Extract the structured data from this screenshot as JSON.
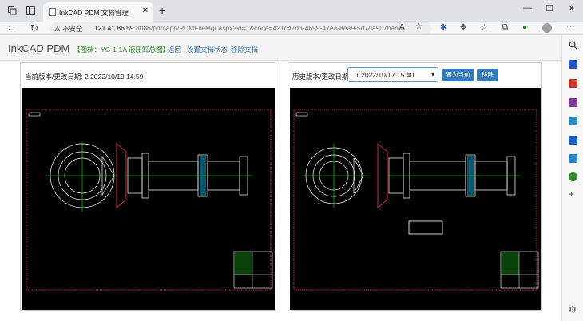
{
  "browser": {
    "tab_title": "InkCAD PDM 文档管理",
    "tab_close": "✕",
    "new_tab": "+",
    "insecure_label": "⚠ 不安全",
    "url_host": "121.41.86.59",
    "url_rest": ":8086/pdmapp/PDMFileMgr.aspx?id=1&code=421c47d3-4699-47ea-8ea9-5d7da907bab6...",
    "window_controls": [
      "—",
      "☐",
      "✕"
    ]
  },
  "header": {
    "brand": "InkCAD PDM",
    "drawing_label": "【图档：YG-1-1A 液压缸总图】",
    "links": {
      "back": "返回",
      "set_status": "设置文档状态",
      "remove_doc": "移除文档"
    }
  },
  "current_panel": {
    "label": "当前版本/更改日期: 2  2022/10/19 14:59"
  },
  "history_panel": {
    "label": "历史版本/更改日期:",
    "selected_version": "1  2022/10/17 15:40",
    "set_current_button": "置为当前",
    "remove_button": "移除"
  },
  "colors": {
    "link": "#337ab7",
    "drawing_label": "#2e8b2e",
    "button_bg": "#337ab7",
    "cad_bg": "#000000",
    "cad_frame": "#ff3b3b"
  }
}
